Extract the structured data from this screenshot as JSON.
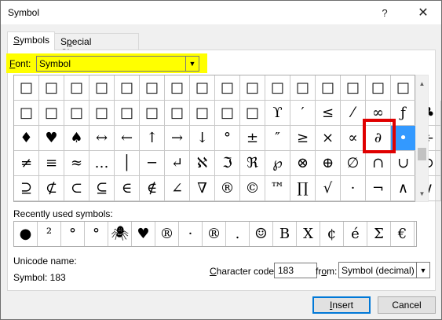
{
  "window": {
    "title": "Symbol",
    "help": "?",
    "close": "✕"
  },
  "tabs": [
    {
      "label": "Symbols",
      "mnemonic": "S",
      "rest": "ymbols"
    },
    {
      "label": "Special Characters",
      "pre": "S",
      "mnemonic": "p",
      "rest": "ecial Characters"
    }
  ],
  "font": {
    "label_mnemonic": "F",
    "label_rest": "ont:",
    "value": "Symbol"
  },
  "grid": {
    "rows": [
      [
        "□",
        "□",
        "□",
        "□",
        "□",
        "□",
        "□",
        "□",
        "□",
        "□",
        "□",
        "□",
        "□",
        "□",
        "□",
        "□"
      ],
      [
        "□",
        "□",
        "□",
        "□",
        "□",
        "□",
        "□",
        "□",
        "□",
        "□",
        "ϒ",
        "′",
        "≤",
        "⁄",
        "∞",
        "ƒ",
        "♣"
      ],
      [
        "♦",
        "♥",
        "♠",
        "↔",
        "←",
        "↑",
        "→",
        "↓",
        "°",
        "±",
        "″",
        "≥",
        "×",
        "∝",
        "∂",
        "•",
        "÷"
      ],
      [
        "≠",
        "≡",
        "≈",
        "…",
        "│",
        "─",
        "↵",
        "ℵ",
        "ℑ",
        "ℜ",
        "℘",
        "⊗",
        "⊕",
        "∅",
        "∩",
        "∪",
        "⊃"
      ],
      [
        "⊇",
        "⊄",
        "⊂",
        "⊆",
        "∈",
        "∉",
        "∠",
        "∇",
        "®",
        "©",
        "™",
        "∏",
        "√",
        "·",
        "¬",
        "∧",
        "∨"
      ]
    ],
    "selected": {
      "row": 2,
      "col": 15
    }
  },
  "recent": {
    "label": "Recently used symbols:",
    "symbols": [
      "●",
      "²",
      "°",
      "°",
      "🕷",
      "♥",
      "®",
      "·",
      "®",
      ".",
      "☺",
      "B",
      "X",
      "¢",
      "é",
      "Σ",
      "€"
    ]
  },
  "unicode": {
    "label": "Unicode name:",
    "value": "Symbol: 183"
  },
  "character_code": {
    "label_mnemonic": "C",
    "label_rest": "haracter code:",
    "value": "183"
  },
  "from": {
    "label_pre": "fr",
    "label_mnemonic": "o",
    "label_rest": "m:",
    "value": "Symbol (decimal)"
  },
  "buttons": {
    "insert": {
      "mnemonic": "I",
      "rest": "nsert"
    },
    "cancel": "Cancel"
  },
  "colors": {
    "highlight": "#ffff00",
    "selected_cell": "#3399ff",
    "selection_frame": "#e00000",
    "default_button_border": "#0078d7"
  }
}
